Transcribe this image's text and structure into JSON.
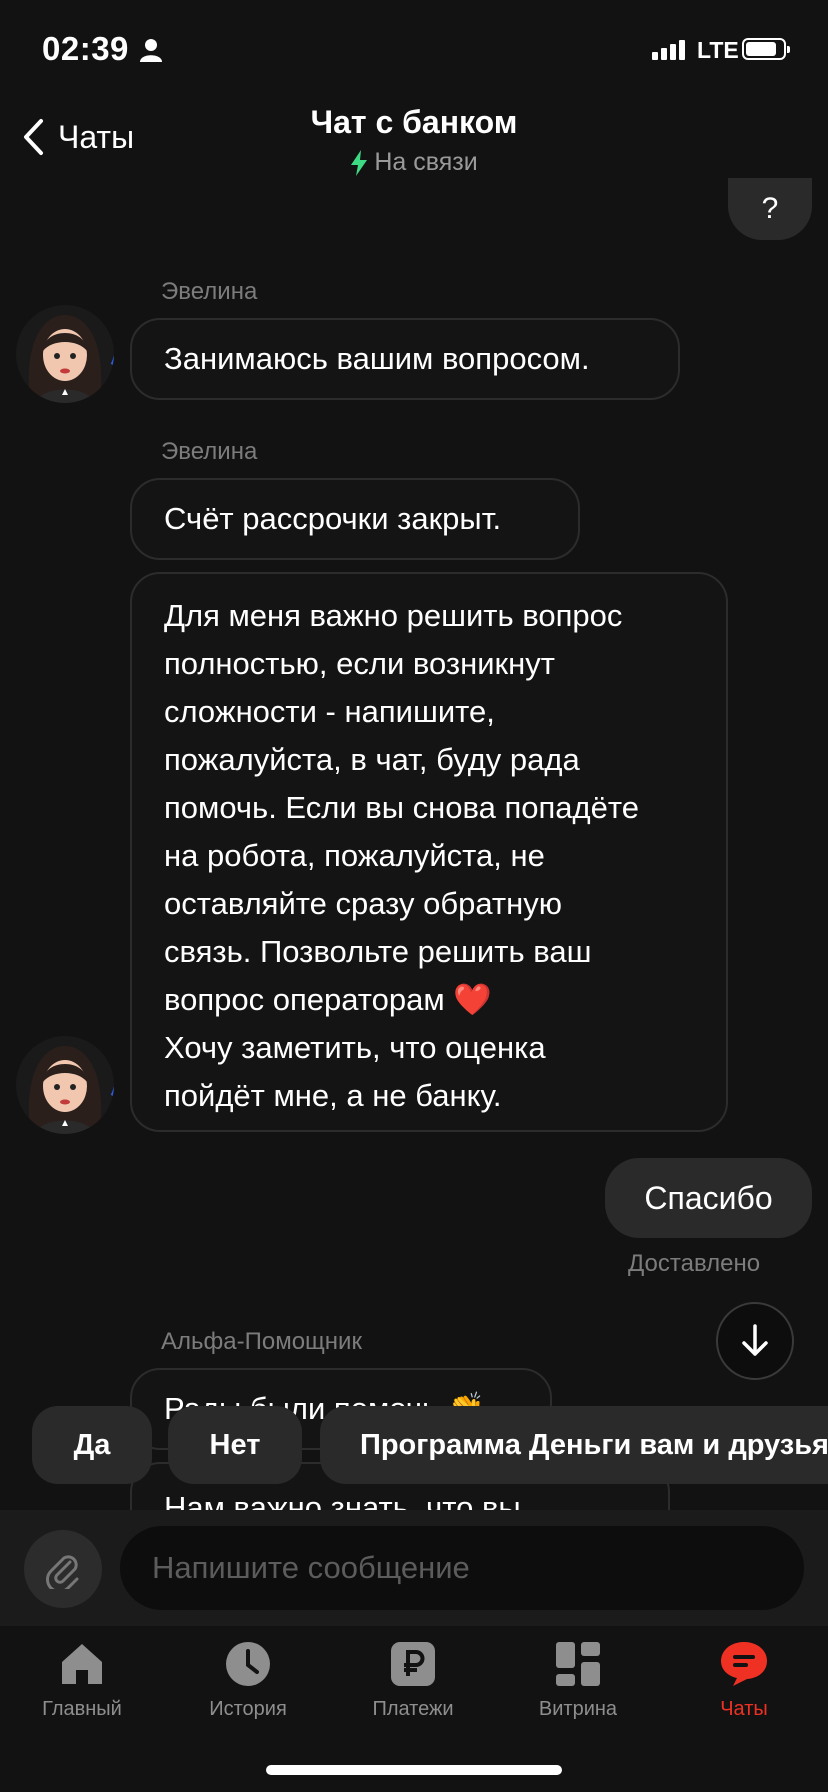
{
  "status_bar": {
    "time": "02:39",
    "network": "LTE",
    "battery_level": 0.85
  },
  "header": {
    "back_label": "Чаты",
    "title": "Чат с банком",
    "subtitle": "На связи",
    "accent_green": "#3ddc84"
  },
  "messages": {
    "partial_out_text": "?",
    "sender1": "Эвелина",
    "msg1": "Занимаюсь вашим вопросом.",
    "sender2": "Эвелина",
    "msg2": "Счёт рассрочки закрыт.",
    "msg3_lines": [
      "Для меня важно решить вопрос",
      "полностью, если возникнут",
      "сложности - напишите,",
      "пожалуйста, в чат, буду рада",
      "помочь. Если вы снова попадёте",
      "на робота, пожалуйста, не",
      "оставляйте сразу обратную",
      "связь. Позвольте решить ваш",
      "вопрос операторам ❤️",
      "Хочу заметить, что оценка",
      "пойдёт мне, а не банку."
    ],
    "out_msg": "Спасибо",
    "delivered": "Доставлено",
    "sender3": "Альфа-Помощник",
    "msg4_partial": "Рады были помочь 👏",
    "msg5_partial": "Нам важно знать, что вы"
  },
  "quick_replies": [
    "Да",
    "Нет",
    "Программа Деньги вам и друзьям"
  ],
  "composer": {
    "placeholder": "Напишите сообщение"
  },
  "tabs": [
    {
      "label": "Главный",
      "icon": "home-icon"
    },
    {
      "label": "История",
      "icon": "clock-icon"
    },
    {
      "label": "Платежи",
      "icon": "ruble-icon"
    },
    {
      "label": "Витрина",
      "icon": "grid-icon"
    },
    {
      "label": "Чаты",
      "icon": "chat-icon",
      "active": true
    }
  ],
  "colors": {
    "accent_red": "#ef3124",
    "background": "#121212",
    "bubble_out": "#2a2a2a"
  }
}
